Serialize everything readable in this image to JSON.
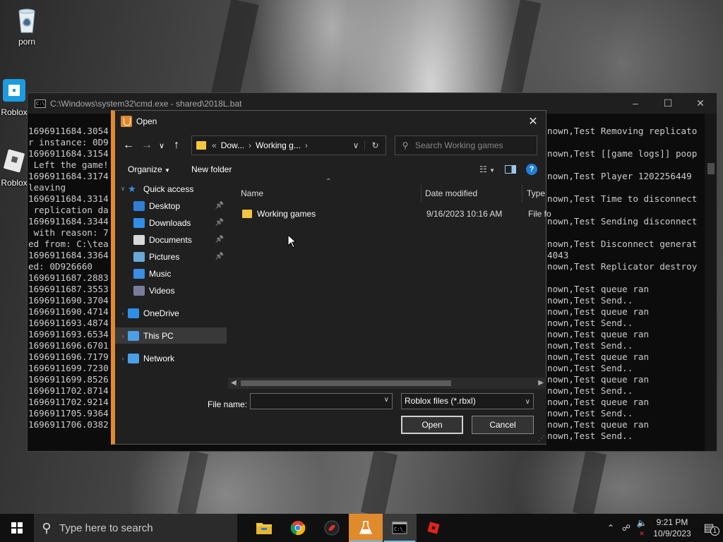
{
  "desktop": {
    "icons": [
      {
        "label": "porn",
        "icon": "recycle-bin-icon"
      },
      {
        "label": "Roblox",
        "icon": "roblox-studio-icon"
      },
      {
        "label": "Roblox",
        "icon": "roblox-player-icon"
      }
    ]
  },
  "cmd": {
    "title": "C:\\Windows\\system32\\cmd.exe - shared\\2018L.bat",
    "left_lines": [
      "1696911684.3054",
      "r instance: 0D9",
      "1696911684.3154",
      " Left the game!",
      "1696911684.3174",
      "leaving",
      "1696911684.3314",
      " replication da",
      "1696911684.3344",
      " with reason: 7",
      "ed from: C:\\tea",
      "1696911684.3364",
      "ed: 0D926660",
      "1696911687.2883",
      "1696911687.3553",
      "1696911690.3704",
      "1696911690.4714",
      "1696911693.4874",
      "1696911693.6534",
      "1696911696.6701",
      "1696911696.7179",
      "1696911699.7230",
      "1696911699.8526",
      "1696911702.8714",
      "1696911702.9214",
      "1696911705.9364",
      "1696911706.0382"
    ],
    "right_lines": [
      "nown,Test Removing replicato",
      "",
      "nown,Test [[game logs]] poop",
      "",
      "nown,Test Player 1202256449",
      "",
      "nown,Test Time to disconnect",
      "",
      "nown,Test Sending disconnect",
      "",
      "nown,Test Disconnect generat",
      "4043",
      "nown,Test Replicator destroy",
      "",
      "nown,Test queue ran",
      "nown,Test Send..",
      "nown,Test queue ran",
      "nown,Test Send..",
      "nown,Test queue ran",
      "nown,Test Send..",
      "nown,Test queue ran",
      "nown,Test Send..",
      "nown,Test queue ran",
      "nown,Test Send..",
      "nown,Test queue ran",
      "nown,Test Send..",
      "nown,Test queue ran",
      "nown,Test Send.."
    ]
  },
  "dialog": {
    "title": "Open",
    "address": {
      "prefix": "«",
      "crumbs": [
        "Dow...",
        "Working g..."
      ]
    },
    "search_placeholder": "Search Working games",
    "toolbar": {
      "organize": "Organize",
      "new_folder": "New folder",
      "help": "?"
    },
    "nav": [
      {
        "label": "Quick access",
        "icon": "star-icon",
        "color": "#3a8ee6",
        "level": 0,
        "expander": "∨"
      },
      {
        "label": "Desktop",
        "icon": "desktop-folder-icon",
        "color": "#2f7fd6",
        "level": 1,
        "pinned": true
      },
      {
        "label": "Downloads",
        "icon": "download-icon",
        "color": "#2f8fe6",
        "level": 1,
        "pinned": true
      },
      {
        "label": "Documents",
        "icon": "document-icon",
        "color": "#d8d8d8",
        "level": 1,
        "pinned": true
      },
      {
        "label": "Pictures",
        "icon": "pictures-icon",
        "color": "#6aa8d8",
        "level": 1,
        "pinned": true
      },
      {
        "label": "Music",
        "icon": "music-icon",
        "color": "#3a8ee6",
        "level": 1
      },
      {
        "label": "Videos",
        "icon": "videos-icon",
        "color": "#7a7a9a",
        "level": 1
      },
      {
        "label": "OneDrive",
        "icon": "onedrive-icon",
        "color": "#2f8fe6",
        "level": 0,
        "expander": "›"
      },
      {
        "label": "This PC",
        "icon": "pc-icon",
        "color": "#4aa0e6",
        "level": 0,
        "expander": "›",
        "selected": true
      },
      {
        "label": "Network",
        "icon": "network-icon",
        "color": "#4aa0e6",
        "level": 0,
        "expander": "›"
      }
    ],
    "columns": {
      "name": "Name",
      "date": "Date modified",
      "type": "Type"
    },
    "files": [
      {
        "name": "Working games",
        "date": "9/16/2023 10:16 AM",
        "type": "File fo"
      }
    ],
    "filename_label": "File name:",
    "filename_value": "",
    "filter_value": "Roblox files (*.rbxl)",
    "open_label": "Open",
    "cancel_label": "Cancel"
  },
  "taskbar": {
    "search_placeholder": "Type here to search",
    "apps": [
      "file-explorer-icon",
      "chrome-icon",
      "app-s-icon",
      "roblox-studio-icon",
      "cmd-icon",
      "roblox-icon"
    ],
    "time": "9:21 PM",
    "date": "10/9/2023",
    "notification_count": "1"
  },
  "colors": {
    "accent": "#e08a2e",
    "selection": "#393939",
    "folder": "#f4c542"
  }
}
